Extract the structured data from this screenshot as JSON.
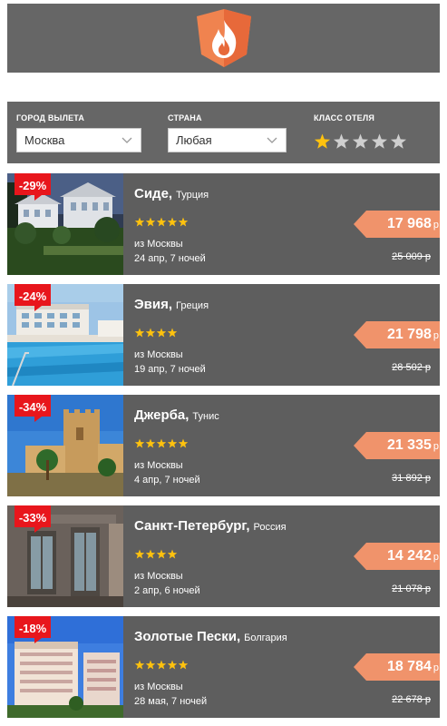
{
  "colors": {
    "panel": "#666666",
    "card": "#5e5e5e",
    "accent": "#f0936b",
    "discount": "#e8161c",
    "star": "#ffc20e",
    "star_empty": "#cfcfcf"
  },
  "logo": {
    "icon": "flame-shield-icon"
  },
  "filters": {
    "city": {
      "label": "ГОРОД ВЫЛЕТА",
      "value": "Москва"
    },
    "country": {
      "label": "СТРАНА",
      "value": "Любая"
    },
    "hotel_class": {
      "label": "КЛАСС ОТЕЛЯ",
      "selected": 1,
      "max": 5
    }
  },
  "offers": [
    {
      "discount": "-29%",
      "name": "Сиде,",
      "country": "Турция",
      "stars": 5,
      "from": "из Москвы",
      "dates": "24 апр, 7 ночей",
      "price": "17 968",
      "currency": "р",
      "old_price": "25 009 р"
    },
    {
      "discount": "-24%",
      "name": "Эвия,",
      "country": "Греция",
      "stars": 4,
      "from": "из Москвы",
      "dates": "19 апр, 7 ночей",
      "price": "21 798",
      "currency": "р",
      "old_price": "28 502 р"
    },
    {
      "discount": "-34%",
      "name": "Джерба,",
      "country": "Тунис",
      "stars": 5,
      "from": "из Москвы",
      "dates": "4 апр, 7 ночей",
      "price": "21 335",
      "currency": "р",
      "old_price": "31 892 р"
    },
    {
      "discount": "-33%",
      "name": "Санкт-Петербург,",
      "country": "Россия",
      "stars": 4,
      "from": "из Москвы",
      "dates": "2 апр, 6 ночей",
      "price": "14 242",
      "currency": "р",
      "old_price": "21 078 р"
    },
    {
      "discount": "-18%",
      "name": "Золотые Пески,",
      "country": "Болгария",
      "stars": 5,
      "from": "из Москвы",
      "dates": "28 мая, 7 ночей",
      "price": "18 784",
      "currency": "р",
      "old_price": "22 678 р"
    }
  ]
}
